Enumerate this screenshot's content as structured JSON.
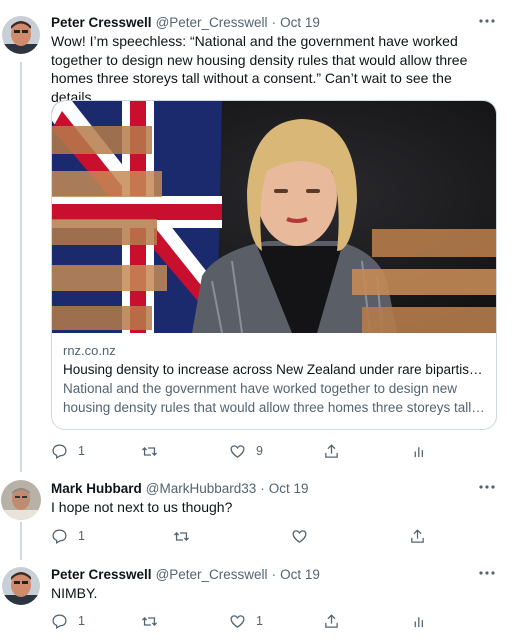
{
  "tweets": [
    {
      "name": "Peter Cresswell",
      "handle": "@Peter_Cresswell",
      "dot": "·",
      "time": "Oct 19",
      "text": "Wow! I’m speechless: “National and the government have worked together to design new housing density rules that would allow three homes three storeys tall without a consent.” Can’t wait to see the details.",
      "card": {
        "domain": "rnz.co.nz",
        "title": "Housing density to increase across New Zealand under rare bipartisan…",
        "desc_line1": "National and the government have worked together to design new",
        "desc_line2": "housing density rules that would allow three homes three storeys tall …"
      },
      "replies": "1",
      "retweets": "",
      "likes": "9"
    },
    {
      "name": "Mark Hubbard",
      "handle": "@MarkHubbard33",
      "dot": "·",
      "time": "Oct 19",
      "text": "I hope not next to us though?",
      "replies": "1",
      "retweets": "",
      "likes": ""
    },
    {
      "name": "Peter Cresswell",
      "handle": "@Peter_Cresswell",
      "dot": "·",
      "time": "Oct 19",
      "text": "NIMBY.",
      "replies": "1",
      "retweets": "",
      "likes": "1"
    }
  ],
  "icons": {
    "reply": "reply-icon",
    "retweet": "retweet-icon",
    "like": "heart-icon",
    "share": "share-icon",
    "analytics": "analytics-icon",
    "more": "more-icon"
  },
  "colors": {
    "text": "#0f1419",
    "secondary": "#536471",
    "border": "#cfd9de"
  }
}
